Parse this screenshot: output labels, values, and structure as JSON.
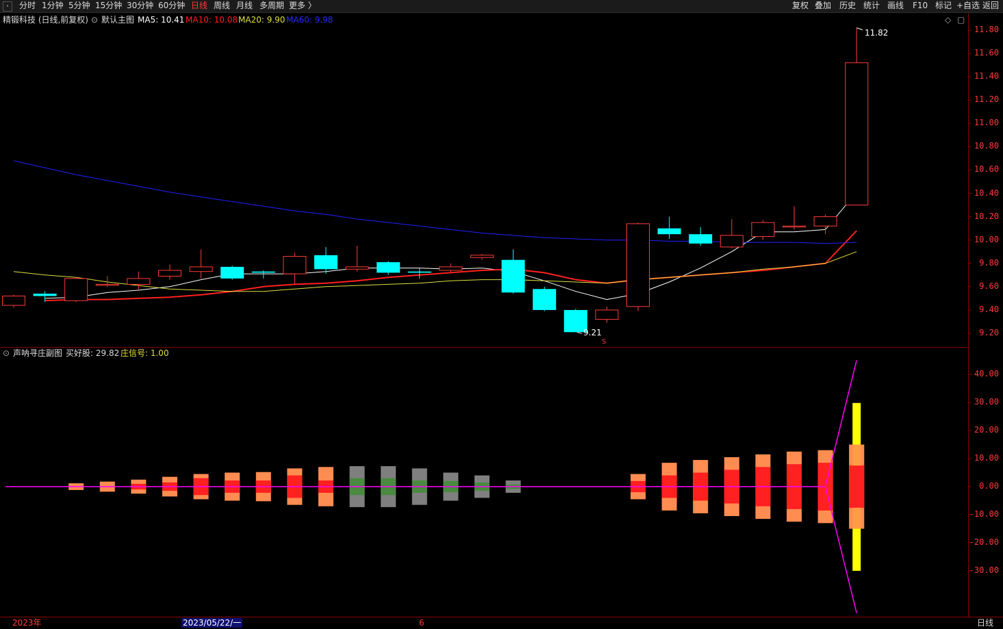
{
  "toolbar": {
    "back_icon": "back-arrow-icon",
    "periods": [
      "分时",
      "1分钟",
      "5分钟",
      "15分钟",
      "30分钟",
      "60分钟",
      "日线",
      "周线",
      "月线",
      "多周期",
      "更多 〉"
    ],
    "active_period": "日线",
    "right_buttons": [
      "复权",
      "叠加",
      "历史",
      "统计",
      "画线",
      "F10",
      "标记",
      "+自选",
      "返回"
    ]
  },
  "main_panel": {
    "stock_label": "精锻科技 (日线,前复权)",
    "template_label": "默认主图",
    "ma5": "MA5: 10.41",
    "ma10": "MA10: 10.08",
    "ma20": "MA20: 9.90",
    "ma60": "MA60: 9.98",
    "high_label": "11.82",
    "low_label": "9.21",
    "marker": "S",
    "y_ticks": [
      "11.80",
      "11.60",
      "11.40",
      "11.20",
      "11.00",
      "10.80",
      "10.60",
      "10.40",
      "10.20",
      "10.00",
      "9.80",
      "9.60",
      "9.40",
      "9.20"
    ]
  },
  "sub_panel": {
    "title": "声呐寻庄副图",
    "buy_label": "买好股: 29.82",
    "signal_label": "庄信号: 1.00",
    "y_ticks": [
      "40.00",
      "30.00",
      "20.00",
      "10.00",
      "0.00",
      "-10.00",
      "-20.00",
      "-30.00"
    ]
  },
  "time_axis": {
    "year_label": "2023年",
    "date_label": "2023/05/22/一",
    "month_label": "6",
    "period_label": "日线"
  },
  "colors": {
    "up": "#ff3b3b",
    "down": "#00ffff",
    "ma5": "#ffffff",
    "ma10": "#ff2020",
    "ma20": "#e0e040",
    "ma60": "#2020ff",
    "sonar_line": "#ff00ff",
    "sonar_inner": "#ff2020",
    "sonar_outer": "#ff8c50",
    "sonar_weak": "#7f7f7f",
    "signal_bar": "#ffff00"
  },
  "chart_data": {
    "type": "candlestick",
    "candles": [
      {
        "open": 9.44,
        "close": 9.52,
        "high": 9.53,
        "low": 9.42
      },
      {
        "open": 9.54,
        "close": 9.52,
        "high": 9.56,
        "low": 9.47
      },
      {
        "open": 9.48,
        "close": 9.67,
        "high": 9.68,
        "low": 9.47
      },
      {
        "open": 9.62,
        "close": 9.62,
        "high": 9.69,
        "low": 9.6
      },
      {
        "open": 9.62,
        "close": 9.67,
        "high": 9.73,
        "low": 9.57
      },
      {
        "open": 9.69,
        "close": 9.74,
        "high": 9.79,
        "low": 9.66
      },
      {
        "open": 9.73,
        "close": 9.77,
        "high": 9.92,
        "low": 9.67
      },
      {
        "open": 9.77,
        "close": 9.67,
        "high": 9.78,
        "low": 9.66
      },
      {
        "open": 9.73,
        "close": 9.72,
        "high": 9.74,
        "low": 9.67
      },
      {
        "open": 9.71,
        "close": 9.86,
        "high": 9.89,
        "low": 9.62
      },
      {
        "open": 9.87,
        "close": 9.75,
        "high": 9.94,
        "low": 9.71
      },
      {
        "open": 9.75,
        "close": 9.77,
        "high": 9.95,
        "low": 9.73
      },
      {
        "open": 9.81,
        "close": 9.72,
        "high": 9.82,
        "low": 9.7
      },
      {
        "open": 9.73,
        "close": 9.72,
        "high": 9.76,
        "low": 9.67
      },
      {
        "open": 9.74,
        "close": 9.77,
        "high": 9.8,
        "low": 9.72
      },
      {
        "open": 9.85,
        "close": 9.87,
        "high": 9.88,
        "low": 9.83
      },
      {
        "open": 9.83,
        "close": 9.55,
        "high": 9.92,
        "low": 9.54
      },
      {
        "open": 9.58,
        "close": 9.4,
        "high": 9.6,
        "low": 9.39
      },
      {
        "open": 9.4,
        "close": 9.21,
        "high": 9.41,
        "low": 9.21
      },
      {
        "open": 9.32,
        "close": 9.4,
        "high": 9.43,
        "low": 9.29
      },
      {
        "open": 9.43,
        "close": 10.14,
        "high": 10.15,
        "low": 9.39
      },
      {
        "open": 10.1,
        "close": 10.05,
        "high": 10.2,
        "low": 10.01
      },
      {
        "open": 10.05,
        "close": 9.97,
        "high": 10.11,
        "low": 9.95
      },
      {
        "open": 9.94,
        "close": 10.04,
        "high": 10.18,
        "low": 9.93
      },
      {
        "open": 10.03,
        "close": 10.15,
        "high": 10.17,
        "low": 10.0
      },
      {
        "open": 10.12,
        "close": 10.12,
        "high": 10.29,
        "low": 10.09
      },
      {
        "open": 10.12,
        "close": 10.2,
        "high": 10.22,
        "low": 10.05
      },
      {
        "open": 10.3,
        "close": 11.52,
        "high": 11.82,
        "low": 10.3
      }
    ],
    "ma_series": [
      {
        "name": "MA5",
        "values": [
          null,
          9.5,
          9.51,
          9.55,
          9.57,
          9.6,
          9.66,
          9.71,
          9.71,
          9.71,
          9.73,
          9.76,
          9.76,
          9.76,
          9.75,
          9.76,
          9.73,
          9.65,
          9.56,
          9.49,
          9.54,
          9.64,
          9.76,
          9.9,
          10.07,
          10.07,
          10.09,
          10.41
        ]
      },
      {
        "name": "MA10",
        "values": [
          null,
          9.48,
          9.49,
          9.49,
          9.5,
          9.51,
          9.53,
          9.56,
          9.6,
          9.62,
          9.63,
          9.65,
          9.68,
          9.7,
          9.72,
          9.74,
          9.75,
          9.72,
          9.66,
          9.63,
          9.66,
          9.68,
          9.7,
          9.72,
          9.74,
          9.77,
          9.8,
          10.08
        ]
      },
      {
        "name": "MA20",
        "values": [
          9.73,
          9.7,
          9.68,
          9.64,
          9.61,
          9.58,
          9.57,
          9.56,
          9.56,
          9.58,
          9.6,
          9.61,
          9.62,
          9.63,
          9.65,
          9.66,
          9.66,
          9.65,
          9.64,
          9.63,
          9.66,
          9.68,
          9.7,
          9.72,
          9.75,
          9.77,
          9.8,
          9.9
        ]
      },
      {
        "name": "MA60",
        "values": [
          10.68,
          10.62,
          10.56,
          10.51,
          10.46,
          10.41,
          10.37,
          10.33,
          10.29,
          10.25,
          10.22,
          10.18,
          10.15,
          10.12,
          10.09,
          10.06,
          10.04,
          10.02,
          10.01,
          10.0,
          10.0,
          9.99,
          9.99,
          9.98,
          9.98,
          9.98,
          9.97,
          9.98
        ]
      }
    ],
    "sonar": {
      "outer": [
        0,
        0,
        1.2,
        1.8,
        2.5,
        3.5,
        4.5,
        5,
        5.2,
        6.5,
        7,
        7.3,
        7.3,
        6.5,
        5,
        4,
        2.2,
        0,
        0,
        0,
        4.5,
        8.5,
        9.5,
        10.5,
        11.5,
        12.5,
        13,
        15
      ],
      "inner": [
        0,
        0,
        0,
        0,
        1,
        1.5,
        3,
        2.2,
        2.2,
        4,
        2.2,
        3,
        3,
        2.2,
        2,
        1.5,
        0.8,
        0,
        0,
        0,
        2,
        4,
        5,
        6,
        7,
        8,
        8.5,
        8
      ],
      "weak": [
        false,
        false,
        false,
        false,
        false,
        false,
        false,
        false,
        false,
        false,
        false,
        true,
        true,
        true,
        true,
        true,
        true,
        false,
        false,
        false,
        false,
        false,
        false,
        false,
        false,
        false,
        false,
        false
      ],
      "signal_bar": {
        "index": 27,
        "top": 29.82,
        "bottom": -30
      }
    }
  }
}
